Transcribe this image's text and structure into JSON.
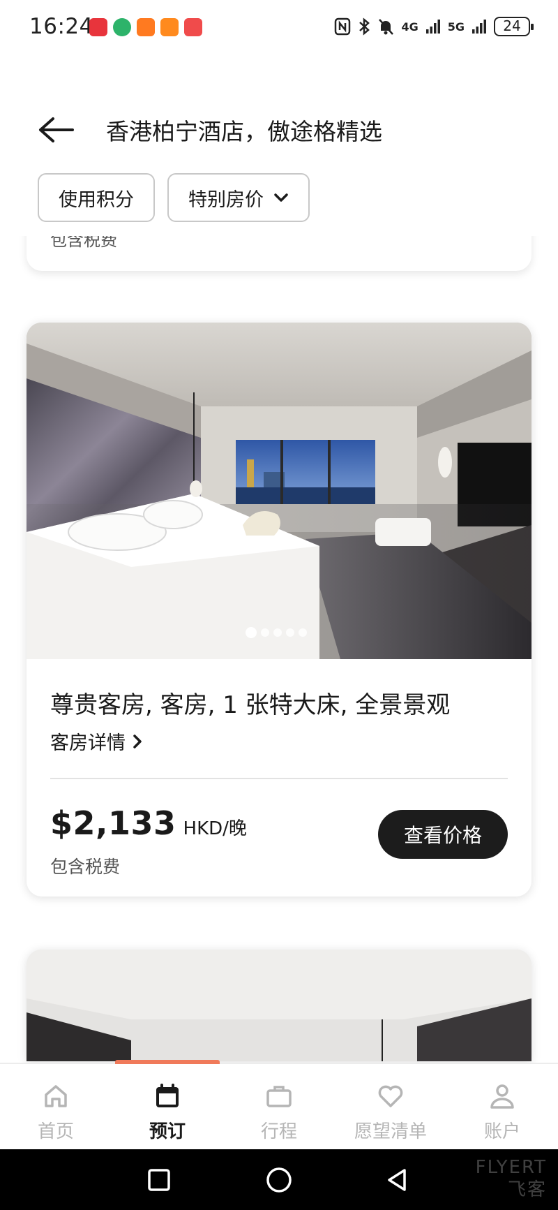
{
  "status_bar": {
    "time": "16:24",
    "network_1": "4G",
    "network_2": "5G",
    "battery": "24"
  },
  "header": {
    "title": "香港柏宁酒店，傲途格精选",
    "filters": {
      "points": "使用积分",
      "special_rate": "特别房价"
    }
  },
  "previous_card": {
    "tax_note": "包含税费"
  },
  "room_card": {
    "name": "尊贵客房, 客房, 1 张特大床, 全景景观",
    "details_link": "客房详情",
    "price_amount": "$2,133",
    "price_unit": "HKD/晚",
    "tax_note": "包含税费",
    "cta": "查看价格",
    "carousel": {
      "total": 5,
      "active": 1
    }
  },
  "tab_bar": {
    "items": [
      {
        "label": "首页",
        "icon": "home-icon"
      },
      {
        "label": "预订",
        "icon": "calendar-icon",
        "active": true
      },
      {
        "label": "行程",
        "icon": "briefcase-icon"
      },
      {
        "label": "愿望清单",
        "icon": "heart-icon"
      },
      {
        "label": "账户",
        "icon": "person-icon"
      }
    ]
  },
  "watermark": {
    "line1": "FLYERT",
    "line2": "飞客"
  },
  "colors": {
    "accent": "#f07a5a",
    "button_dark": "#1c1c1c",
    "inactive_tab": "#b5b5b5"
  }
}
